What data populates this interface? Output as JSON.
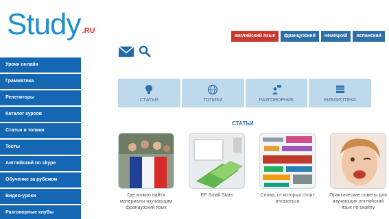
{
  "logo": {
    "main": "Study",
    "suffix": ".RU"
  },
  "languages": [
    {
      "label": "английский язык",
      "active": true
    },
    {
      "label": "французский",
      "active": false
    },
    {
      "label": "немецкий",
      "active": false
    },
    {
      "label": "испанский",
      "active": false
    }
  ],
  "header_icons": {
    "mail": "envelope-icon",
    "search": "search-icon"
  },
  "sidebar": {
    "items": [
      {
        "label": "Уроки онлайн"
      },
      {
        "label": "Грамматика"
      },
      {
        "label": "Репетиторы"
      },
      {
        "label": "Каталог курсов"
      },
      {
        "label": "Статьи и топики"
      },
      {
        "label": "Тесты"
      },
      {
        "label": "Английский по skype"
      },
      {
        "label": "Обучение за рубежом"
      },
      {
        "label": "Видео-уроки"
      },
      {
        "label": "Разговорные клубы"
      }
    ]
  },
  "categories": [
    {
      "label": "СТАТЬИ",
      "icon": "lightbulb-icon"
    },
    {
      "label": "ТОПИКИ",
      "icon": "globe-icon"
    },
    {
      "label": "РАЗГОВОРНИК",
      "icon": "speech-person-icon"
    },
    {
      "label": "БИБЛИОТЕКА",
      "icon": "books-icon"
    }
  ],
  "section": {
    "title": "СТАТЬИ"
  },
  "articles": [
    {
      "title": "Где можно найти материалы изучающим французский язык"
    },
    {
      "title": "EF Small Stars"
    },
    {
      "title": "Слова, от которых стоит отказаться"
    },
    {
      "title": "Практические советы для изучающих английский язык по скайпу"
    }
  ],
  "colors": {
    "brand": "#1e8fce",
    "nav": "#1567b4",
    "accent_red": "#c83a30",
    "category_bg": "#bfd9ec"
  }
}
